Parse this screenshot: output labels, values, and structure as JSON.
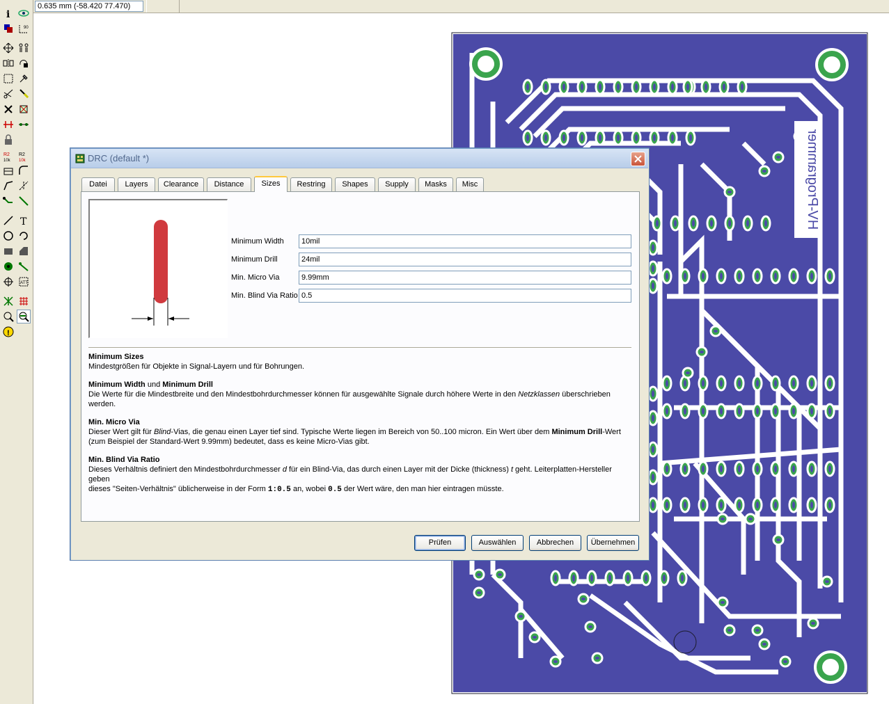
{
  "status_bar": {
    "coordinates": "0.635 mm (-58.420 77.470)"
  },
  "toolbar": {
    "tools": [
      {
        "name": "info-icon"
      },
      {
        "name": "show-icon"
      },
      {
        "name": "display-layers-icon"
      },
      {
        "name": "mark-icon"
      },
      {
        "name": "move-icon"
      },
      {
        "name": "copy-icon"
      },
      {
        "name": "mirror-icon"
      },
      {
        "name": "rotate-icon"
      },
      {
        "name": "group-icon"
      },
      {
        "name": "change-icon"
      },
      {
        "name": "cut-icon"
      },
      {
        "name": "paste-icon"
      },
      {
        "name": "delete-icon"
      },
      {
        "name": "add-icon"
      },
      {
        "name": "optimize-icon"
      },
      {
        "name": "split-icon"
      },
      {
        "name": "lock-icon"
      },
      {
        "name": "name-icon"
      },
      {
        "name": "value-icon"
      },
      {
        "name": "smash-icon"
      },
      {
        "name": "miter-icon"
      },
      {
        "name": "route-icon"
      },
      {
        "name": "ripup-icon"
      },
      {
        "name": "signal-icon"
      },
      {
        "name": "wire-icon"
      },
      {
        "name": "line-icon"
      },
      {
        "name": "text-icon"
      },
      {
        "name": "circle-icon"
      },
      {
        "name": "arc-icon"
      },
      {
        "name": "rect-icon"
      },
      {
        "name": "polygon-icon"
      },
      {
        "name": "via-icon"
      },
      {
        "name": "connection-icon"
      },
      {
        "name": "hole-icon"
      },
      {
        "name": "attribute-icon"
      },
      {
        "name": "ratsnest-icon"
      },
      {
        "name": "autorouter-icon"
      },
      {
        "name": "drc-icon"
      },
      {
        "name": "errors-icon"
      },
      {
        "name": "errors-warning-icon"
      }
    ]
  },
  "dialog": {
    "title": "DRC (default *)",
    "tabs": [
      {
        "label": "Datei",
        "selected": false
      },
      {
        "label": "Layers",
        "selected": false
      },
      {
        "label": "Clearance",
        "selected": false
      },
      {
        "label": "Distance",
        "selected": false
      },
      {
        "label": "Sizes",
        "selected": true
      },
      {
        "label": "Restring",
        "selected": false
      },
      {
        "label": "Shapes",
        "selected": false
      },
      {
        "label": "Supply",
        "selected": false
      },
      {
        "label": "Masks",
        "selected": false
      },
      {
        "label": "Misc",
        "selected": false
      }
    ],
    "fields": [
      {
        "label": "Minimum Width",
        "value": "10mil"
      },
      {
        "label": "Minimum Drill",
        "value": "24mil"
      },
      {
        "label": "Min. Micro Via",
        "value": "9.99mm"
      },
      {
        "label": "Min. Blind Via Ratio",
        "value": "0.5"
      }
    ],
    "help": {
      "s1_head": "Minimum Sizes",
      "s1_text": "Mindestgrößen für Objekte in Signal-Layern und für Bohrungen.",
      "s2_head_a": "Minimum Width",
      "s2_head_und": " und ",
      "s2_head_b": "Minimum Drill",
      "s2_text_a": "Die Werte für die Mindestbreite und den Mindestbohrdurchmesser können für ausgewählte Signale durch höhere Werte in den ",
      "s2_text_em": "Netzklassen",
      "s2_text_b": " überschrieben werden.",
      "s3_head": "Min. Micro Via",
      "s3_text_a": "Dieser Wert gilt für ",
      "s3_text_em": "Blind",
      "s3_text_b": "-Vias, die genau einen Layer tief sind. Typische Werte liegen im Bereich von 50..100 micron. Ein Wert über dem ",
      "s3_text_strong": "Minimum Drill",
      "s3_text_c": "-Wert",
      "s3_text_d": "(zum Beispiel der Standard-Wert 9.99mm) bedeutet, dass es keine Micro-Vias gibt.",
      "s4_head": "Min. Blind Via Ratio",
      "s4_text_a": "Dieses Verhältnis definiert den Mindestbohrdurchmesser ",
      "s4_text_d": "d",
      "s4_text_b": " für ein Blind-Via, das durch einen Layer mit der Dicke (thickness) ",
      "s4_text_t": "t",
      "s4_text_c": " geht. Leiterplatten-Hersteller geben",
      "s4_text_e": "dieses \"Seiten-Verhältnis\" üblicherweise in der Form ",
      "s4_text_ratio": "1:0.5",
      "s4_text_f": " an, wobei ",
      "s4_text_val": "0.5",
      "s4_text_g": " der Wert wäre, den man hier eintragen müsste."
    },
    "buttons": {
      "check": "Prüfen",
      "select": "Auswählen",
      "cancel": "Abbrechen",
      "apply": "Übernehmen"
    }
  },
  "board": {
    "label": "HV-Programmer",
    "colors": {
      "substrate": "#4b4aa7",
      "pad": "#3aa44d",
      "trace": "#ffffff",
      "outline": "#1c1c2c"
    }
  }
}
